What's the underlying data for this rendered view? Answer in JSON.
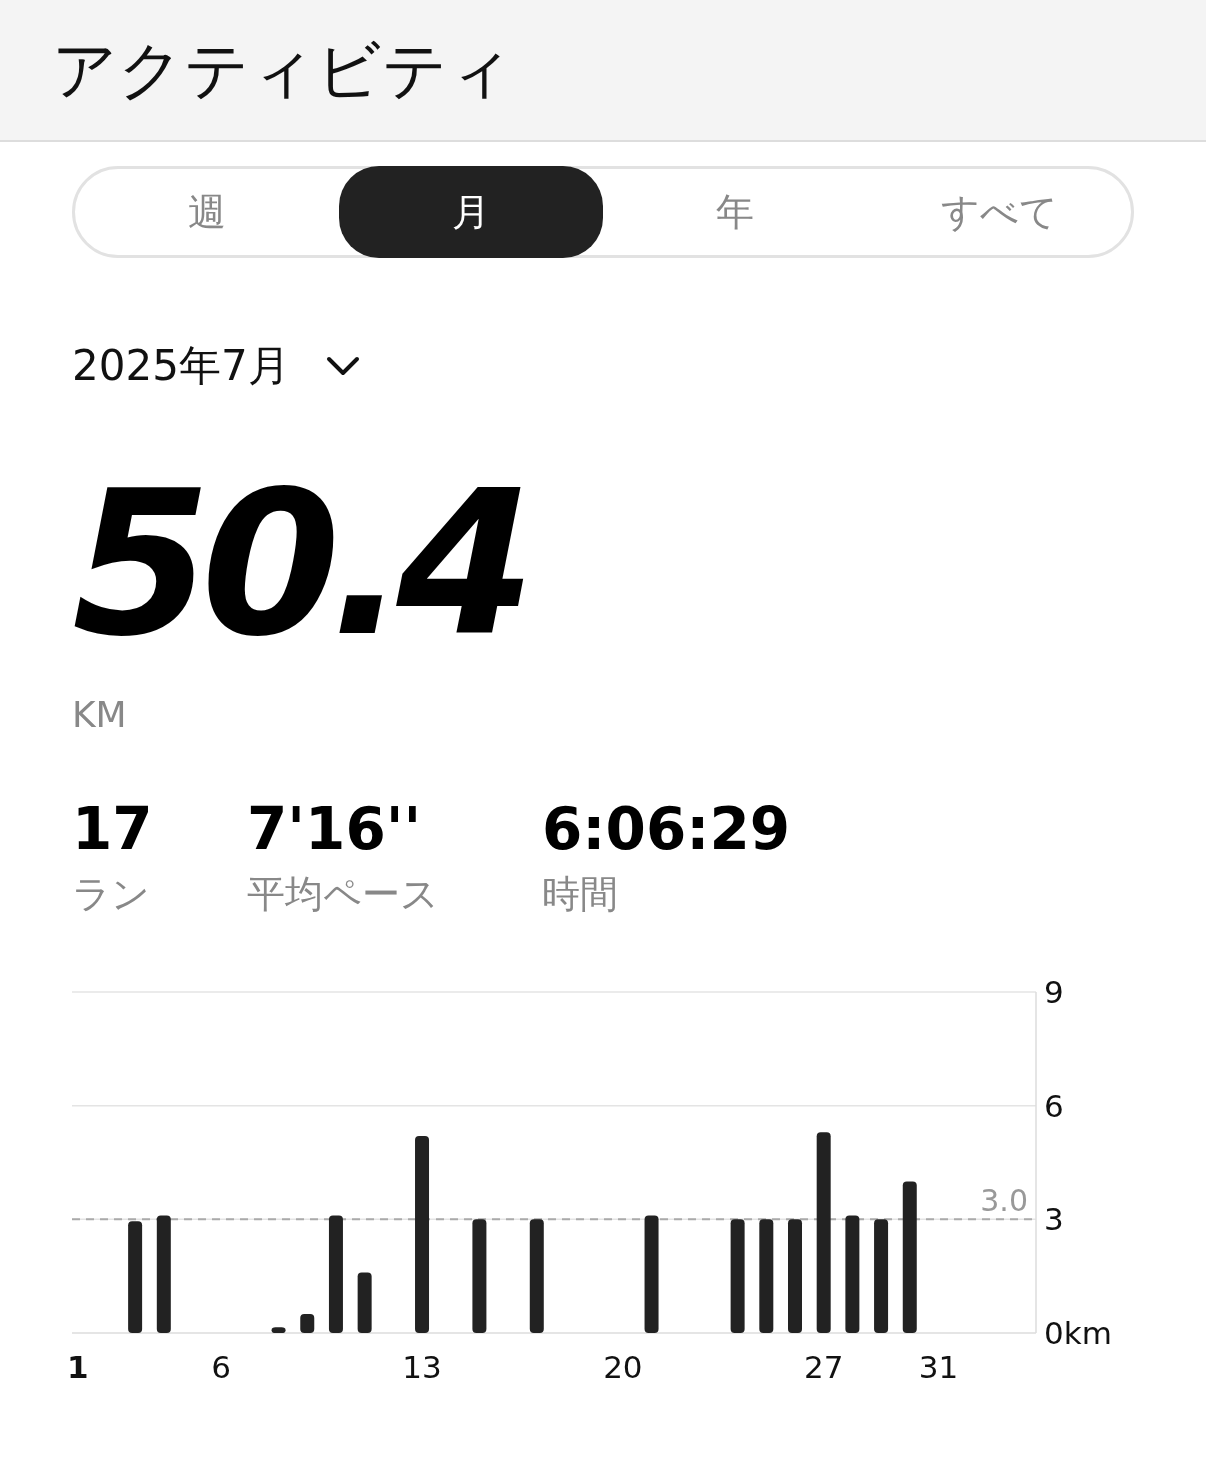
{
  "header": {
    "title": "アクティビティ"
  },
  "tabs": [
    {
      "label": "週",
      "selected": false
    },
    {
      "label": "月",
      "selected": true
    },
    {
      "label": "年",
      "selected": false
    },
    {
      "label": "すべて",
      "selected": false
    }
  ],
  "period": {
    "label": "2025年7月"
  },
  "total": {
    "value": "50.4",
    "unit": "KM"
  },
  "stats": [
    {
      "value": "17",
      "label": "ラン"
    },
    {
      "value": "7'16''",
      "label": "平均ペース"
    },
    {
      "value": "6:06:29",
      "label": "時間"
    }
  ],
  "chart_data": {
    "type": "bar",
    "x": [
      3,
      4,
      8,
      9,
      10,
      11,
      13,
      15,
      17,
      21,
      24,
      25,
      26,
      27,
      28,
      29,
      30
    ],
    "series": [
      {
        "color": "#222222",
        "values": [
          2.95,
          3.1,
          0.15,
          0.5,
          3.1,
          1.6,
          5.2,
          3.0,
          3.0,
          3.1,
          3.0,
          3.0,
          3.0,
          5.3,
          3.1,
          3.0,
          4.0
        ]
      }
    ],
    "xlim": [
      0.8,
      34.4
    ],
    "ylim": [
      0,
      9
    ],
    "xticks": [
      {
        "value": 1,
        "label": "1"
      },
      {
        "value": 6,
        "label": "6"
      },
      {
        "value": 13,
        "label": "13"
      },
      {
        "value": 20,
        "label": "20"
      },
      {
        "value": 27,
        "label": "27"
      },
      {
        "value": 31,
        "label": "31"
      }
    ],
    "yticks": [
      {
        "value": 0,
        "label": "0km"
      },
      {
        "value": 3,
        "label": "3"
      },
      {
        "value": 6,
        "label": "6"
      },
      {
        "value": 9,
        "label": "9"
      }
    ],
    "ref_lines": [
      {
        "axis": "y",
        "value": 3.0,
        "label": "3.0"
      }
    ]
  }
}
